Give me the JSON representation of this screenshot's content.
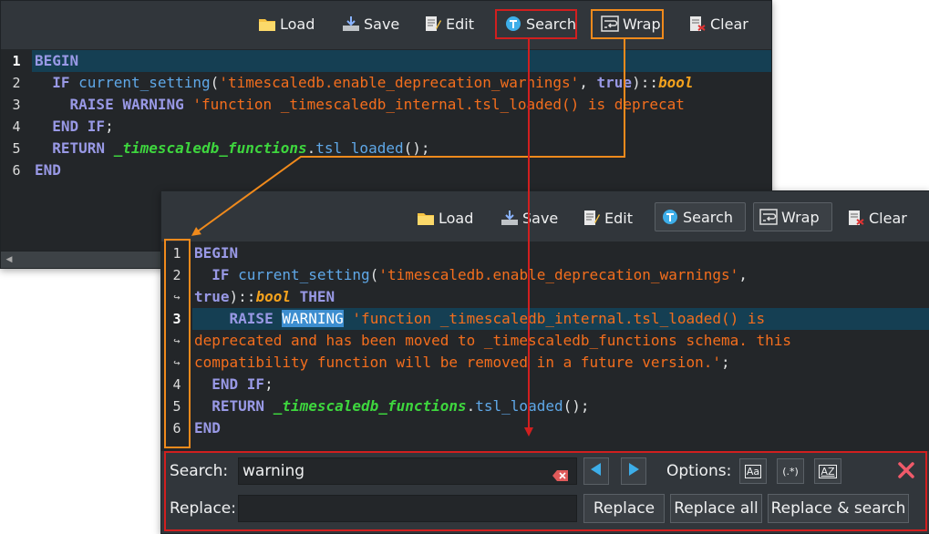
{
  "toolbar": {
    "load": "Load",
    "save": "Save",
    "edit": "Edit",
    "search": "Search",
    "wrap": "Wrap",
    "clear": "Clear"
  },
  "top_editor": {
    "line_numbers": [
      "1",
      "2",
      "3",
      "4",
      "5",
      "6"
    ],
    "lines": [
      {
        "parts": [
          {
            "t": "BEGIN",
            "c": "kw"
          }
        ]
      },
      {
        "parts": [
          {
            "t": "  "
          },
          {
            "t": "IF",
            "c": "kw"
          },
          {
            "t": " "
          },
          {
            "t": "current_setting",
            "c": "fn"
          },
          {
            "t": "("
          },
          {
            "t": "'timescaledb.enable_deprecation_warnings'",
            "c": "str"
          },
          {
            "t": ", "
          },
          {
            "t": "true",
            "c": "kw"
          },
          {
            "t": ")::"
          },
          {
            "t": "bool",
            "c": "typ"
          }
        ]
      },
      {
        "parts": [
          {
            "t": "    "
          },
          {
            "t": "RAISE WARNING",
            "c": "kw"
          },
          {
            "t": " "
          },
          {
            "t": "'function _timescaledb_internal.tsl_loaded() is deprecat",
            "c": "str"
          }
        ]
      },
      {
        "parts": [
          {
            "t": "  "
          },
          {
            "t": "END IF",
            "c": "kw"
          },
          {
            "t": ";"
          }
        ]
      },
      {
        "parts": [
          {
            "t": "  "
          },
          {
            "t": "RETURN",
            "c": "kw"
          },
          {
            "t": " "
          },
          {
            "t": "_timescaledb_functions",
            "c": "ext"
          },
          {
            "t": "."
          },
          {
            "t": "tsl_loaded",
            "c": "fn"
          },
          {
            "t": "();"
          }
        ]
      },
      {
        "parts": [
          {
            "t": "END",
            "c": "kw"
          }
        ]
      }
    ]
  },
  "bottom_editor": {
    "line_numbers": [
      "1",
      "2",
      "↪",
      "3",
      "↪",
      "↪",
      "4",
      "5",
      "6"
    ],
    "lines": [
      {
        "parts": [
          {
            "t": "BEGIN",
            "c": "kw"
          }
        ]
      },
      {
        "parts": [
          {
            "t": "  "
          },
          {
            "t": "IF",
            "c": "kw"
          },
          {
            "t": " "
          },
          {
            "t": "current_setting",
            "c": "fn"
          },
          {
            "t": "("
          },
          {
            "t": "'timescaledb.enable_deprecation_warnings'",
            "c": "str"
          },
          {
            "t": ","
          }
        ]
      },
      {
        "parts": [
          {
            "t": "true",
            "c": "kw"
          },
          {
            "t": ")::"
          },
          {
            "t": "bool",
            "c": "typ"
          },
          {
            "t": " "
          },
          {
            "t": "THEN",
            "c": "kw"
          }
        ]
      },
      {
        "parts": [
          {
            "t": "    "
          },
          {
            "t": "RAISE",
            "c": "kw"
          },
          {
            "t": " "
          },
          {
            "t": "WARNING",
            "c": "hl"
          },
          {
            "t": " "
          },
          {
            "t": "'function _timescaledb_internal.tsl_loaded() is",
            "c": "str"
          }
        ]
      },
      {
        "parts": [
          {
            "t": "deprecated and has been moved to _timescaledb_functions schema. this",
            "c": "str"
          }
        ]
      },
      {
        "parts": [
          {
            "t": "compatibility function will be removed in a future version.'",
            "c": "str"
          },
          {
            "t": ";"
          }
        ]
      },
      {
        "parts": [
          {
            "t": "  "
          },
          {
            "t": "END IF",
            "c": "kw"
          },
          {
            "t": ";"
          }
        ]
      },
      {
        "parts": [
          {
            "t": "  "
          },
          {
            "t": "RETURN",
            "c": "kw"
          },
          {
            "t": " "
          },
          {
            "t": "_timescaledb_functions",
            "c": "ext"
          },
          {
            "t": "."
          },
          {
            "t": "tsl_loaded",
            "c": "fn"
          },
          {
            "t": "();"
          }
        ]
      },
      {
        "parts": [
          {
            "t": "END",
            "c": "kw"
          }
        ]
      }
    ]
  },
  "search_panel": {
    "search_label": "Search:",
    "search_value": "warning",
    "options_label": "Options:",
    "opt_case": "Aa",
    "opt_regex": "(.*)",
    "opt_word": "AZ",
    "replace_label": "Replace:",
    "replace_value": "",
    "replace_btn": "Replace",
    "replace_all_btn": "Replace all",
    "replace_search_btn": "Replace & search"
  },
  "colors": {
    "annotation_red": "#d11f1f",
    "annotation_orange": "#f08a1c"
  }
}
